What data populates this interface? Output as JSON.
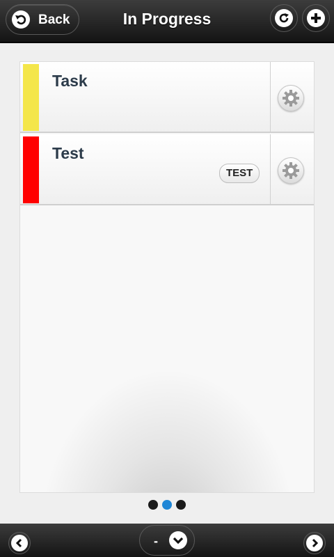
{
  "header": {
    "title": "In Progress",
    "back_label": "Back",
    "back_icon": "back-arrow-icon",
    "refresh_icon": "refresh-icon",
    "add_icon": "plus-icon"
  },
  "tasks": [
    {
      "title": "Task",
      "color": "#f4e64a",
      "tag": ""
    },
    {
      "title": "Test",
      "color": "#ff0000",
      "tag": "TEST"
    }
  ],
  "pager": {
    "pages": 3,
    "active": 2
  },
  "footer": {
    "status_label": "-",
    "prev_icon": "chevron-left-icon",
    "next_icon": "chevron-right-icon",
    "dropdown_icon": "chevron-down-icon"
  },
  "colors": {
    "accent": "#1f86d6",
    "header_bg": "#1a1a1a",
    "title_text": "#2c3b4a"
  }
}
